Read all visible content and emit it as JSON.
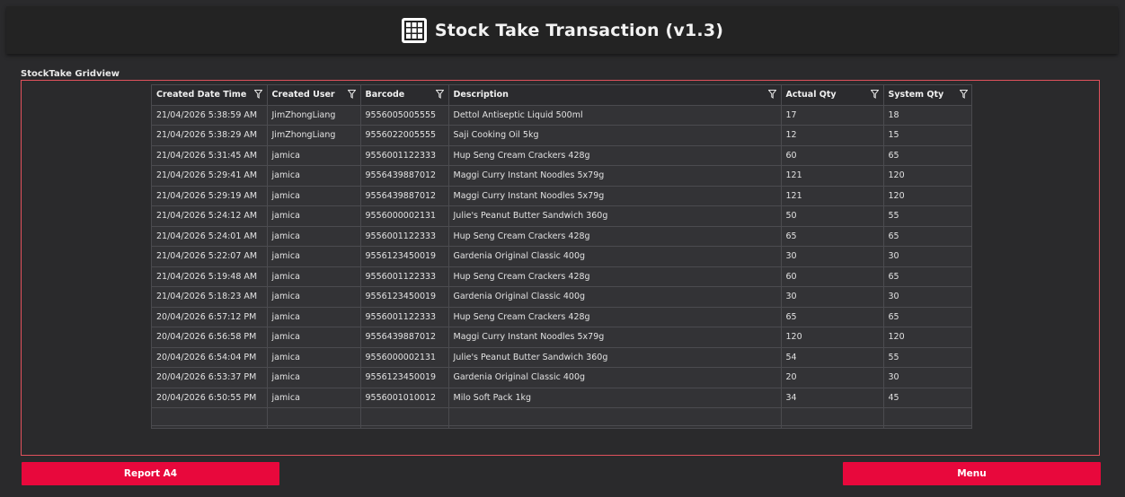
{
  "header": {
    "title": "Stock Take Transaction (v1.3)",
    "icon": "grid-icon"
  },
  "section_label": "StockTake Gridview",
  "columns": [
    "Created Date Time",
    "Created User",
    "Barcode",
    "Description",
    "Actual Qty",
    "System Qty"
  ],
  "rows": [
    [
      "21/04/2026 5:38:59 AM",
      "JimZhongLiang",
      "9556005005555",
      "Dettol Antiseptic Liquid 500ml",
      "17",
      "18"
    ],
    [
      "21/04/2026 5:38:29 AM",
      "JimZhongLiang",
      "9556022005555",
      "Saji Cooking Oil 5kg",
      "12",
      "15"
    ],
    [
      "21/04/2026 5:31:45 AM",
      "jamica",
      "9556001122333",
      "Hup Seng Cream Crackers 428g",
      "60",
      "65"
    ],
    [
      "21/04/2026 5:29:41 AM",
      "jamica",
      "9556439887012",
      "Maggi Curry Instant Noodles 5x79g",
      "121",
      "120"
    ],
    [
      "21/04/2026 5:29:19 AM",
      "jamica",
      "9556439887012",
      "Maggi Curry Instant Noodles 5x79g",
      "121",
      "120"
    ],
    [
      "21/04/2026 5:24:12 AM",
      "jamica",
      "9556000002131",
      "Julie's Peanut Butter Sandwich 360g",
      "50",
      "55"
    ],
    [
      "21/04/2026 5:24:01 AM",
      "jamica",
      "9556001122333",
      "Hup Seng Cream Crackers 428g",
      "65",
      "65"
    ],
    [
      "21/04/2026 5:22:07 AM",
      "jamica",
      "9556123450019",
      "Gardenia Original Classic 400g",
      "30",
      "30"
    ],
    [
      "21/04/2026 5:19:48 AM",
      "jamica",
      "9556001122333",
      "Hup Seng Cream Crackers 428g",
      "60",
      "65"
    ],
    [
      "21/04/2026 5:18:23 AM",
      "jamica",
      "9556123450019",
      "Gardenia Original Classic 400g",
      "30",
      "30"
    ],
    [
      "20/04/2026 6:57:12 PM",
      "jamica",
      "9556001122333",
      "Hup Seng Cream Crackers 428g",
      "65",
      "65"
    ],
    [
      "20/04/2026 6:56:58 PM",
      "jamica",
      "9556439887012",
      "Maggi Curry Instant Noodles 5x79g",
      "120",
      "120"
    ],
    [
      "20/04/2026 6:54:04 PM",
      "jamica",
      "9556000002131",
      "Julie's Peanut Butter Sandwich 360g",
      "54",
      "55"
    ],
    [
      "20/04/2026 6:53:37 PM",
      "jamica",
      "9556123450019",
      "Gardenia Original Classic 400g",
      "20",
      "30"
    ],
    [
      "20/04/2026 6:50:55 PM",
      "jamica",
      "9556001010012",
      "Milo Soft Pack 1kg",
      "34",
      "45"
    ]
  ],
  "buttons": {
    "report": "Report A4",
    "menu": "Menu"
  },
  "colors": {
    "accent": "#e8083c",
    "frame": "#e0515c",
    "background": "#2a2a2c"
  },
  "icons": {
    "column_filter": "filter-icon"
  }
}
